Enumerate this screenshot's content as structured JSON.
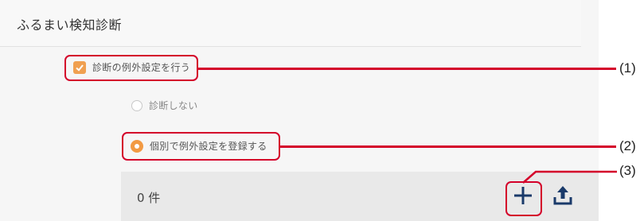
{
  "panel": {
    "title": "ふるまい検知診断"
  },
  "options": {
    "exception_checkbox_label": "診断の例外設定を行う",
    "exception_checkbox_checked": true,
    "radio_no_diagnosis_label": "診断しない",
    "radio_individual_label": "個別で例外設定を登録する",
    "selected_radio": "個別で例外設定を登録する"
  },
  "list": {
    "count_text": "0 件"
  },
  "icons": {
    "add": "plus-icon",
    "upload": "upload-icon"
  },
  "callouts": {
    "c1": "(1)",
    "c2": "(2)",
    "c3": "(3)"
  },
  "colors": {
    "accent_orange": "#f29a43",
    "highlight_red": "#d4002a",
    "icon_navy": "#1a3a6a"
  }
}
